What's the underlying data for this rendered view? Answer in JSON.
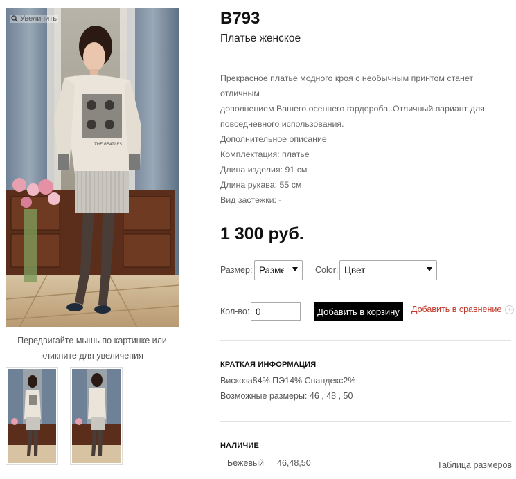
{
  "gallery": {
    "zoom_label": "Увеличить",
    "hint_line1": "Передвигайте мышь по картинке или",
    "hint_line2": "кликните для увеличения",
    "print_text": "THE BEATLES"
  },
  "product": {
    "sku": "B793",
    "subtitle": "Платье женское",
    "description": [
      "Прекрасное платье модного кроя с необычным принтом станет отличным",
      "дополнением Вашего осеннего гардероба..Отличный вариант для",
      "повседневного использования.",
      "Дополнительное описание",
      "Комплектация: платье",
      "Длина изделия: 91 см",
      "Длина рукава: 55 см",
      "Вид застежки: -"
    ],
    "price": "1 300 руб."
  },
  "options": {
    "size_label": "Размер:",
    "size_value": "Размер",
    "color_label": "Color:",
    "color_value": "Цвет",
    "qty_label": "Кол-во:",
    "qty_value": "0",
    "add_to_cart": "Добавить в корзину",
    "add_to_compare": "Добавить в сравнение"
  },
  "short_info": {
    "title": "КРАТКАЯ ИНФОРМАЦИЯ",
    "lines": [
      "Вискоза84% ПЭ14% Спандекс2%",
      "Возможные размеры: 46 , 48 , 50"
    ]
  },
  "availability": {
    "title": "НАЛИЧИЕ",
    "color": "Бежевый",
    "sizes": "46,48,50",
    "size_table_link": "Таблица размеров"
  },
  "colors": {
    "accent_red": "#c0392b",
    "button_black": "#000000",
    "divider": "#e2e2e2",
    "text_gray": "#555555"
  },
  "icons": [
    "magnifier-icon",
    "chevron-down-icon",
    "plus-circle-icon"
  ]
}
